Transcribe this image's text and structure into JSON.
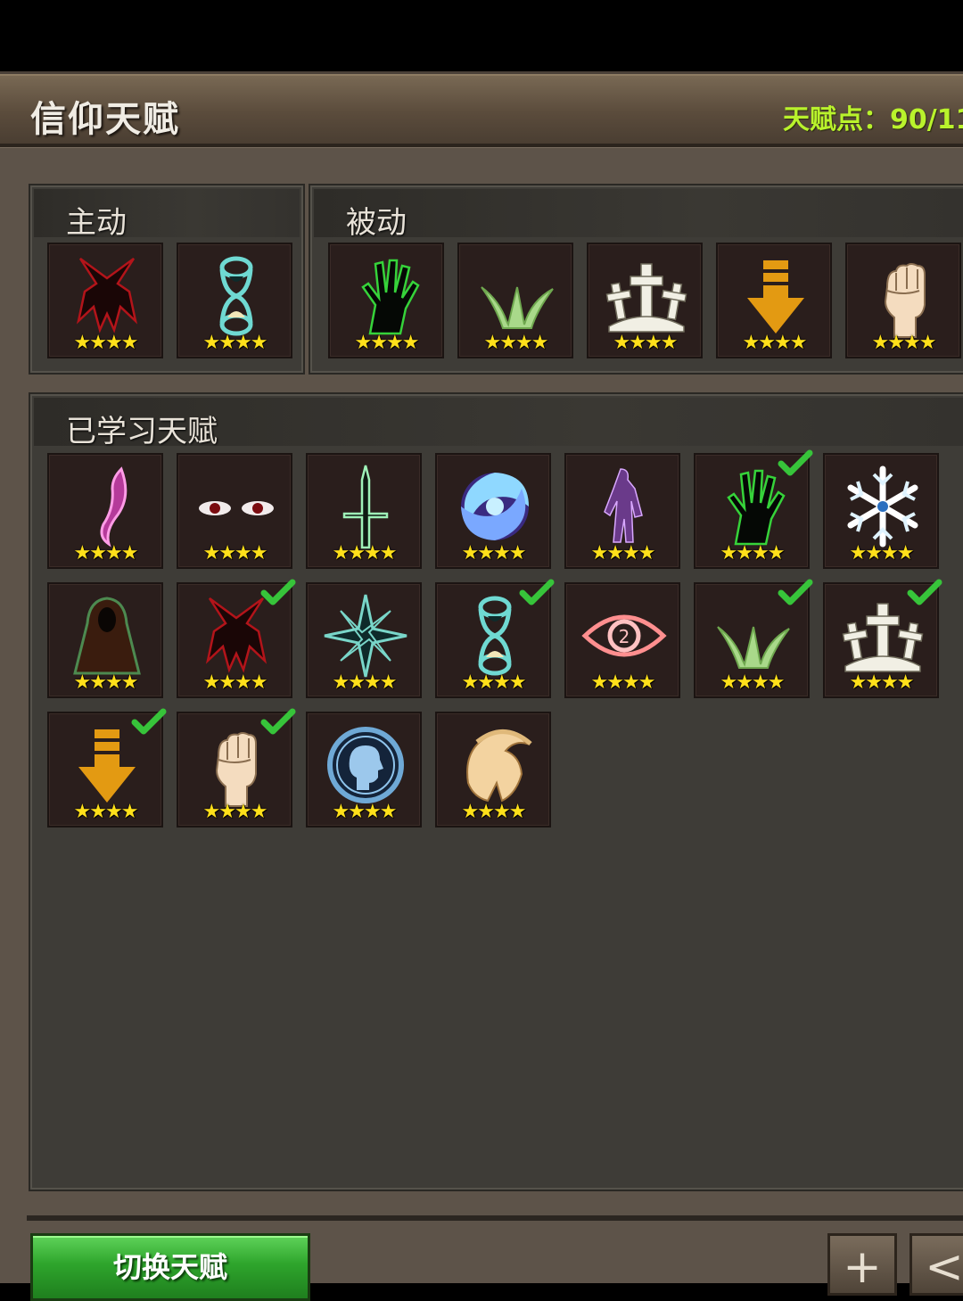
{
  "header": {
    "title": "信仰天赋",
    "points_label": "天赋点：",
    "points_value": "90/11"
  },
  "active": {
    "title": "主动",
    "slots": [
      {
        "icon": "red-demon-icon",
        "stars": "★★★★"
      },
      {
        "icon": "hourglass-icon",
        "stars": "★★★★"
      }
    ]
  },
  "passive": {
    "title": "被动",
    "slots": [
      {
        "icon": "green-hand-icon",
        "stars": "★★★★"
      },
      {
        "icon": "green-grass-icon",
        "stars": "★★★★"
      },
      {
        "icon": "crosses-icon",
        "stars": "★★★★"
      },
      {
        "icon": "down-arrow-icon",
        "stars": "★★★★"
      },
      {
        "icon": "fist-icon",
        "stars": "★★★★"
      }
    ]
  },
  "learned": {
    "title": "已学习天赋",
    "slots": [
      {
        "icon": "pink-hook-icon",
        "stars": "★★★★",
        "checked": false
      },
      {
        "icon": "red-eyes-icon",
        "stars": "★★★★",
        "checked": false
      },
      {
        "icon": "green-cross-sword-icon",
        "stars": "★★★★",
        "checked": false
      },
      {
        "icon": "vortex-icon",
        "stars": "★★★★",
        "checked": false
      },
      {
        "icon": "purple-figure-icon",
        "stars": "★★★★",
        "checked": false
      },
      {
        "icon": "green-hand-icon",
        "stars": "★★★★",
        "checked": true
      },
      {
        "icon": "snowflake-icon",
        "stars": "★★★★",
        "checked": false
      },
      {
        "icon": "hooded-cloak-icon",
        "stars": "★★★★",
        "checked": false
      },
      {
        "icon": "red-demon-icon",
        "stars": "★★★★",
        "checked": true
      },
      {
        "icon": "compass-star-icon",
        "stars": "★★★★",
        "checked": false
      },
      {
        "icon": "hourglass-icon",
        "stars": "★★★★",
        "checked": true
      },
      {
        "icon": "eye-icon",
        "stars": "★★★★",
        "checked": false
      },
      {
        "icon": "green-grass-icon",
        "stars": "★★★★",
        "checked": true
      },
      {
        "icon": "crosses-icon",
        "stars": "★★★★",
        "checked": true
      },
      {
        "icon": "down-arrow-icon",
        "stars": "★★★★",
        "checked": true
      },
      {
        "icon": "fist-icon",
        "stars": "★★★★",
        "checked": true
      },
      {
        "icon": "head-circle-icon",
        "stars": "★★★★",
        "checked": false
      },
      {
        "icon": "spartan-helmet-icon",
        "stars": "★★★★",
        "checked": false
      }
    ]
  },
  "footer": {
    "switch_label": "切换天赋",
    "plus_label": "+",
    "back_label": "<"
  }
}
